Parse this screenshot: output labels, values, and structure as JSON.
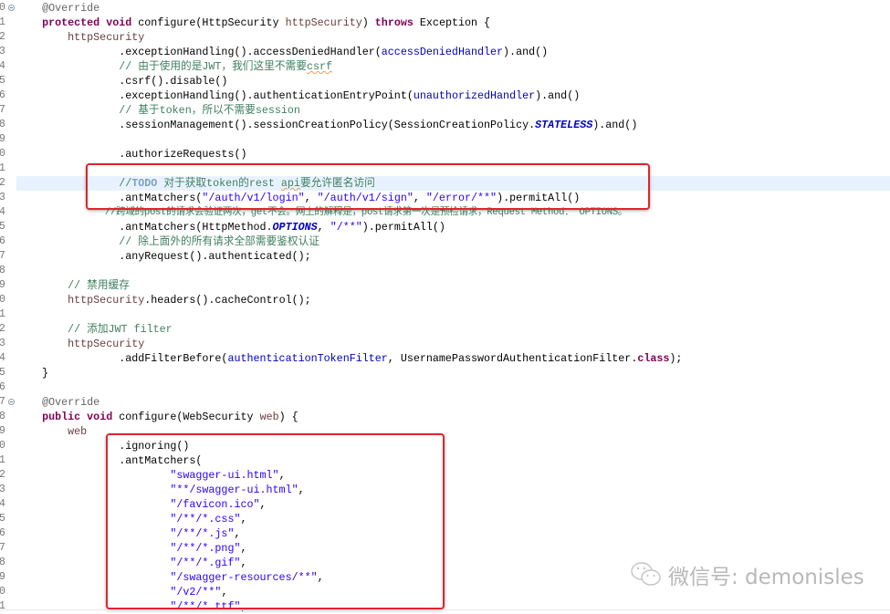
{
  "editor": {
    "current_line": 12,
    "colors": {
      "keyword": "#7f0055",
      "string": "#2a00ff",
      "comment": "#3f7f5f",
      "field": "#0000c0",
      "highlight_box": "#e0242f",
      "current_line_bg": "#e8f2fe"
    },
    "lines": [
      {
        "n": "0",
        "fold": true,
        "tokens": [
          [
            "    ",
            ""
          ],
          [
            "@Override",
            "a"
          ]
        ]
      },
      {
        "n": "1",
        "tokens": [
          [
            "    ",
            ""
          ],
          [
            "protected",
            "k"
          ],
          [
            " ",
            ""
          ],
          [
            "void",
            "k"
          ],
          [
            " configure(HttpSecurity ",
            ""
          ],
          [
            "httpSecurity",
            "p"
          ],
          [
            ") ",
            ""
          ],
          [
            "throws",
            "k"
          ],
          [
            " Exception {",
            ""
          ]
        ]
      },
      {
        "n": "2",
        "tokens": [
          [
            "        ",
            ""
          ],
          [
            "httpSecurity",
            "p"
          ]
        ]
      },
      {
        "n": "3",
        "tokens": [
          [
            "                .exceptionHandling().accessDeniedHandler(",
            ""
          ],
          [
            "accessDeniedHandler",
            "f"
          ],
          [
            ").and()",
            ""
          ]
        ]
      },
      {
        "n": "4",
        "tokens": [
          [
            "                ",
            ""
          ],
          [
            "// 由于使用的是JWT，我们这里不需要",
            "c"
          ],
          [
            "csrf",
            "c sq"
          ]
        ]
      },
      {
        "n": "5",
        "tokens": [
          [
            "                .csrf().disable()",
            ""
          ]
        ]
      },
      {
        "n": "6",
        "tokens": [
          [
            "                .exceptionHandling().authenticationEntryPoint(",
            ""
          ],
          [
            "unauthorizedHandler",
            "f"
          ],
          [
            ").and()",
            ""
          ]
        ]
      },
      {
        "n": "7",
        "tokens": [
          [
            "                ",
            ""
          ],
          [
            "// 基于token，所以不需要session",
            "c"
          ]
        ]
      },
      {
        "n": "8",
        "tokens": [
          [
            "                .sessionManagement().sessionCreationPolicy(SessionCreationPolicy.",
            ""
          ],
          [
            "STATELESS",
            "st"
          ],
          [
            ").and()",
            ""
          ]
        ]
      },
      {
        "n": "9",
        "tokens": []
      },
      {
        "n": "0",
        "tokens": [
          [
            "                .authorizeRequests()",
            ""
          ]
        ]
      },
      {
        "n": "1",
        "tokens": []
      },
      {
        "n": "2",
        "tokens": [
          [
            "                ",
            ""
          ],
          [
            "//",
            "c"
          ],
          [
            "TODO",
            "td"
          ],
          [
            " 对于获取token的rest ",
            "c"
          ],
          [
            "api",
            "c sq"
          ],
          [
            "要允许匿名访问",
            "c"
          ]
        ]
      },
      {
        "n": "3",
        "tokens": [
          [
            "                .antMatchers(",
            ""
          ],
          [
            "\"/auth/v1/login\"",
            "s"
          ],
          [
            ", ",
            ""
          ],
          [
            "\"/auth/v1/sign\"",
            "s"
          ],
          [
            ", ",
            ""
          ],
          [
            "\"/error/**\"",
            "s"
          ],
          [
            ").permitAll()",
            ""
          ]
        ]
      },
      {
        "n": "4",
        "small": true,
        "tokens": [
          [
            "                ",
            ""
          ],
          [
            "//跨域的post的请求会验证两次，get不会。网上的解释是，post请求第一次是预检请求，Request Method： OPTIONS。",
            "c"
          ]
        ]
      },
      {
        "n": "5",
        "tokens": [
          [
            "                .antMatchers(HttpMethod.",
            ""
          ],
          [
            "OPTIONS",
            "st"
          ],
          [
            ", ",
            ""
          ],
          [
            "\"/**\"",
            "s"
          ],
          [
            ").permitAll()",
            ""
          ]
        ]
      },
      {
        "n": "6",
        "tokens": [
          [
            "                ",
            ""
          ],
          [
            "// 除上面外的所有请求全部需要鉴权认证",
            "c"
          ]
        ]
      },
      {
        "n": "7",
        "tokens": [
          [
            "                .anyRequest().authenticated();",
            ""
          ]
        ]
      },
      {
        "n": "8",
        "tokens": []
      },
      {
        "n": "9",
        "tokens": [
          [
            "        ",
            ""
          ],
          [
            "// 禁用缓存",
            "c"
          ]
        ]
      },
      {
        "n": "0",
        "tokens": [
          [
            "        ",
            ""
          ],
          [
            "httpSecurity",
            "p"
          ],
          [
            ".headers().cacheControl();",
            ""
          ]
        ]
      },
      {
        "n": "1",
        "tokens": []
      },
      {
        "n": "2",
        "tokens": [
          [
            "        ",
            ""
          ],
          [
            "// 添加JWT filter",
            "c"
          ]
        ]
      },
      {
        "n": "3",
        "tokens": [
          [
            "        ",
            ""
          ],
          [
            "httpSecurity",
            "p"
          ]
        ]
      },
      {
        "n": "4",
        "tokens": [
          [
            "                .addFilterBefore(",
            ""
          ],
          [
            "authenticationTokenFilter",
            "f"
          ],
          [
            ", UsernamePasswordAuthenticationFilter.",
            ""
          ],
          [
            "class",
            "k"
          ],
          [
            ");",
            ""
          ]
        ]
      },
      {
        "n": "5",
        "tokens": [
          [
            "    }",
            ""
          ]
        ]
      },
      {
        "n": "6",
        "tokens": []
      },
      {
        "n": "7",
        "fold": true,
        "tokens": [
          [
            "    ",
            ""
          ],
          [
            "@Override",
            "a"
          ]
        ]
      },
      {
        "n": "8",
        "tokens": [
          [
            "    ",
            ""
          ],
          [
            "public",
            "k"
          ],
          [
            " ",
            ""
          ],
          [
            "void",
            "k"
          ],
          [
            " configure(WebSecurity ",
            ""
          ],
          [
            "web",
            "p"
          ],
          [
            ") {",
            ""
          ]
        ]
      },
      {
        "n": "9",
        "tokens": [
          [
            "        ",
            ""
          ],
          [
            "web",
            "p"
          ]
        ]
      },
      {
        "n": "0",
        "tokens": [
          [
            "                .ignoring()",
            ""
          ]
        ]
      },
      {
        "n": "1",
        "tokens": [
          [
            "                .antMatchers(",
            ""
          ]
        ]
      },
      {
        "n": "2",
        "tokens": [
          [
            "                        ",
            ""
          ],
          [
            "\"swagger-ui.html\"",
            "s"
          ],
          [
            ",",
            ""
          ]
        ]
      },
      {
        "n": "3",
        "tokens": [
          [
            "                        ",
            ""
          ],
          [
            "\"**/swagger-ui.html\"",
            "s"
          ],
          [
            ",",
            ""
          ]
        ]
      },
      {
        "n": "4",
        "tokens": [
          [
            "                        ",
            ""
          ],
          [
            "\"/favicon.ico\"",
            "s"
          ],
          [
            ",",
            ""
          ]
        ]
      },
      {
        "n": "5",
        "tokens": [
          [
            "                        ",
            ""
          ],
          [
            "\"/**/*.css\"",
            "s"
          ],
          [
            ",",
            ""
          ]
        ]
      },
      {
        "n": "6",
        "tokens": [
          [
            "                        ",
            ""
          ],
          [
            "\"/**/*.js\"",
            "s"
          ],
          [
            ",",
            ""
          ]
        ]
      },
      {
        "n": "7",
        "tokens": [
          [
            "                        ",
            ""
          ],
          [
            "\"/**/*.png\"",
            "s"
          ],
          [
            ",",
            ""
          ]
        ]
      },
      {
        "n": "8",
        "tokens": [
          [
            "                        ",
            ""
          ],
          [
            "\"/**/*.gif\"",
            "s"
          ],
          [
            ",",
            ""
          ]
        ]
      },
      {
        "n": "9",
        "tokens": [
          [
            "                        ",
            ""
          ],
          [
            "\"/swagger-resources/**\"",
            "s"
          ],
          [
            ",",
            ""
          ]
        ]
      },
      {
        "n": "0",
        "tokens": [
          [
            "                        ",
            ""
          ],
          [
            "\"/v2/**\"",
            "s"
          ],
          [
            ",",
            ""
          ]
        ]
      },
      {
        "n": "1",
        "tokens": [
          [
            "                        ",
            ""
          ],
          [
            "\"/**/*.ttf\"",
            "s"
          ],
          [
            ",",
            ""
          ]
        ]
      }
    ]
  },
  "watermark": {
    "icon": "wechat-icon",
    "text": "微信号: demonisles"
  }
}
